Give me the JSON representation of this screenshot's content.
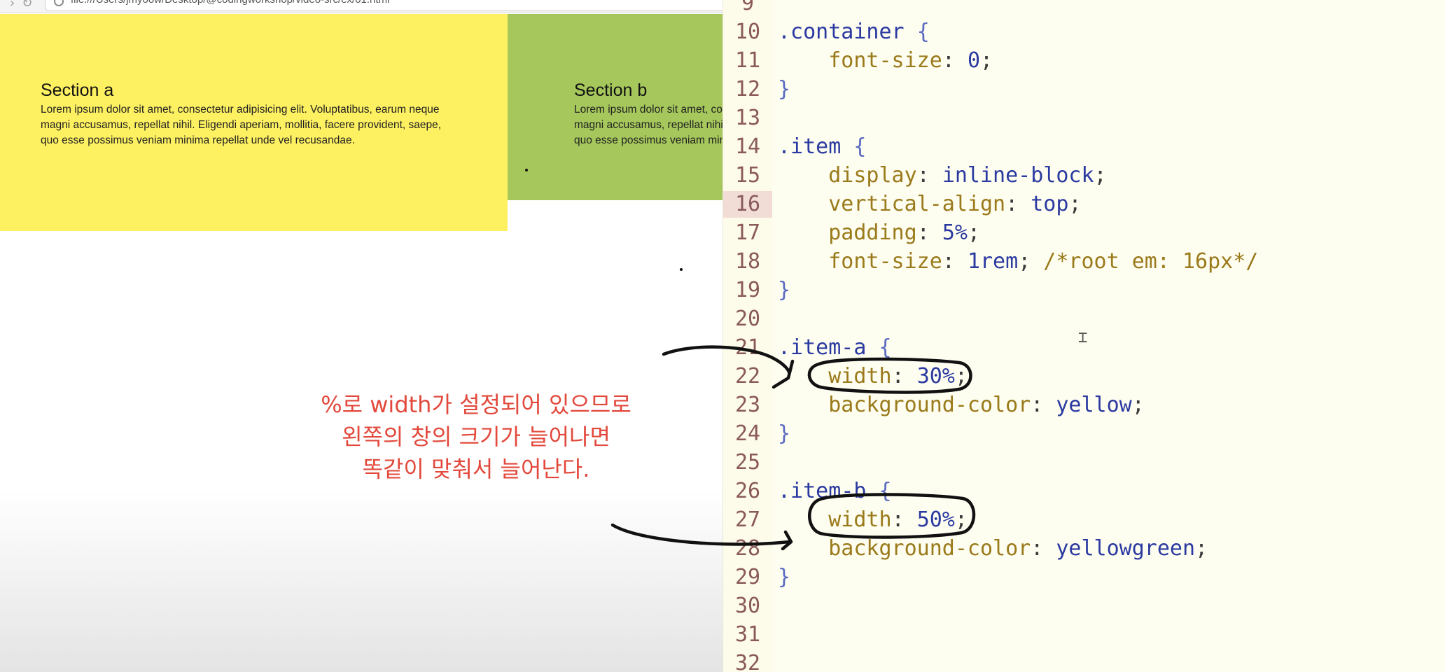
{
  "browser": {
    "url": "file:///Users/jmyoow/Desktop/@codingworkshop/video-src/ex/01.html",
    "section_a": {
      "title": "Section a",
      "body": "Lorem ipsum dolor sit amet, consectetur adipisicing elit. Voluptatibus, earum neque magni accusamus, repellat nihil. Eligendi aperiam, mollitia, facere provident, saepe, quo esse possimus veniam minima repellat unde vel recusandae.",
      "color": "#fdf061"
    },
    "section_b": {
      "title": "Section b",
      "body": "Lorem ipsum dolor sit amet, consectetur adipisicing elit. Voluptatibus, earum neque magni accusamus, repellat nihil. Eligendi aperiam, mollitia, facere provident, saepe, quo esse possimus veniam minima",
      "color": "#a5c75b"
    }
  },
  "annotation": {
    "text": "%로 width가 설정되어 있으므로\n왼쪽의 창의 크기가 늘어나면\n똑같이 맞춰서 늘어난다.",
    "color": "#e2483b"
  },
  "editor": {
    "active_line": "16",
    "lines": [
      {
        "n": "9",
        "code": ""
      },
      {
        "n": "10",
        "code": ".container {"
      },
      {
        "n": "11",
        "code": "    font-size: 0;"
      },
      {
        "n": "12",
        "code": "}"
      },
      {
        "n": "13",
        "code": ""
      },
      {
        "n": "14",
        "code": ".item {"
      },
      {
        "n": "15",
        "code": "    display: inline-block;"
      },
      {
        "n": "16",
        "code": "    vertical-align: top;"
      },
      {
        "n": "17",
        "code": "    padding: 5%;"
      },
      {
        "n": "18",
        "code": "    font-size: 1rem; /*root em: 16px*/"
      },
      {
        "n": "19",
        "code": "}"
      },
      {
        "n": "20",
        "code": ""
      },
      {
        "n": "21",
        "code": ".item-a {"
      },
      {
        "n": "22",
        "code": "    width: 30%;"
      },
      {
        "n": "23",
        "code": "    background-color: yellow;"
      },
      {
        "n": "24",
        "code": "}"
      },
      {
        "n": "25",
        "code": ""
      },
      {
        "n": "26",
        "code": ".item-b {"
      },
      {
        "n": "27",
        "code": "    width: 50%;"
      },
      {
        "n": "28",
        "code": "    background-color: yellowgreen;"
      },
      {
        "n": "29",
        "code": "}"
      },
      {
        "n": "30",
        "code": ""
      },
      {
        "n": "31",
        "code": ""
      },
      {
        "n": "32",
        "code": ""
      }
    ]
  }
}
